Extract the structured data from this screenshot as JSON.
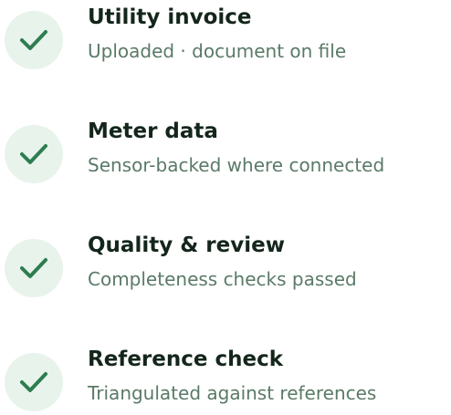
{
  "checklist": {
    "items": [
      {
        "title": "Utility invoice",
        "description": "Uploaded · document on file",
        "status": "complete",
        "icon": "check-icon"
      },
      {
        "title": "Meter data",
        "description": "Sensor-backed where connected",
        "status": "complete",
        "icon": "check-icon"
      },
      {
        "title": "Quality & review",
        "description": "Completeness checks passed",
        "status": "complete",
        "icon": "check-icon"
      },
      {
        "title": "Reference check",
        "description": "Triangulated against references",
        "status": "complete",
        "icon": "check-icon"
      }
    ]
  },
  "colors": {
    "badge_bg": "#e8f3ec",
    "check": "#2e7d4f",
    "title": "#14261b",
    "description": "#5a7a67"
  }
}
